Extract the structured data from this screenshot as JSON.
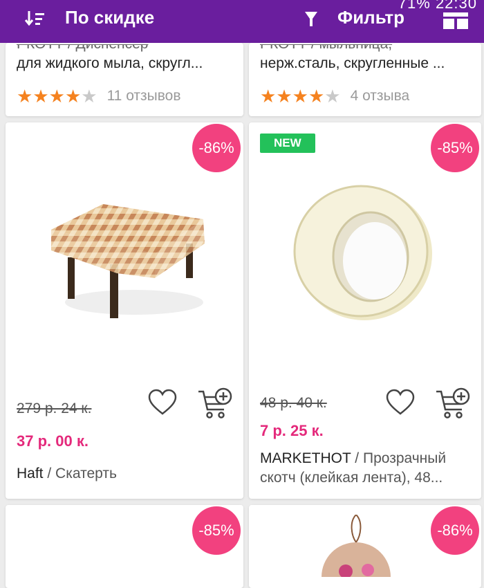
{
  "toolbar": {
    "sort_label": "По скидке",
    "filter_label": "Фильтр",
    "status_text": "71% 22:30",
    "colors": {
      "bar": "#6a1e9e"
    }
  },
  "top_products": [
    {
      "title_line1": "РКОТТ / Диспенсер",
      "title_line2": "для жидкого мыла, скругл...",
      "stars": 4,
      "reviews": "11 отзывов"
    },
    {
      "title_line1": "РКОТТ / мыльница,",
      "title_line2": "нерж.сталь, скругленные ...",
      "stars": 4,
      "reviews": "4 отзыва"
    }
  ],
  "products": [
    {
      "discount": "-86%",
      "old_price": "279 р. 24 к.",
      "new_price": "37 р. 00 к.",
      "brand": "Haft",
      "separator": " / ",
      "name": "Скатерть",
      "image": "tablecloth-table"
    },
    {
      "badge": "NEW",
      "discount": "-85%",
      "old_price": "48 р. 40 к.",
      "new_price": "7 р. 25 к.",
      "brand": "MARKETHOT",
      "separator": " / ",
      "name": "Прозрачный скотч (клейкая лента), 48...",
      "image": "clear-tape-roll"
    }
  ],
  "bottom_products": [
    {
      "discount": "-85%"
    },
    {
      "discount": "-86%",
      "image": "knitted-ornament"
    }
  ],
  "icons": {
    "sort": "sort-icon",
    "filter": "filter-icon",
    "layout": "grid-layout-icon",
    "heart": "heart-icon",
    "cart": "add-to-cart-icon"
  },
  "colors": {
    "discount": "#f2417f",
    "new_badge": "#23c15a",
    "price": "#e4297b",
    "star": "#f5821f"
  }
}
